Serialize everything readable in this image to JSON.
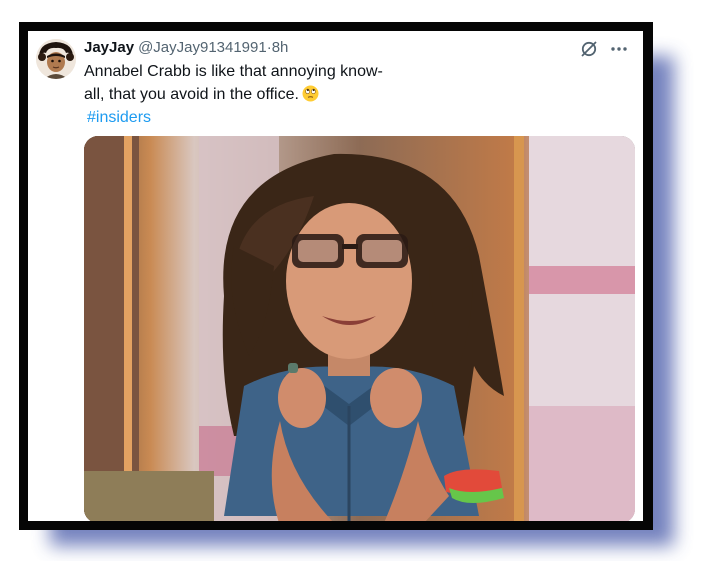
{
  "tweet": {
    "display_name": "JayJay",
    "handle": "@JayJay91341991",
    "separator": "·",
    "time": "8h",
    "text_line1": "Annabel Crabb is like that annoying know-",
    "text_line2": "all, that you avoid in the office.",
    "emoji": "face-with-rolling-eyes",
    "hashtag": "#insiders"
  },
  "icons": {
    "grok": "grok-icon",
    "more": "more-options-icon"
  },
  "colors": {
    "hashtag": "#1d9bf0",
    "text": "#0f1419",
    "muted": "#536471",
    "frame": "#050505",
    "shadow": "#5d6db3"
  }
}
